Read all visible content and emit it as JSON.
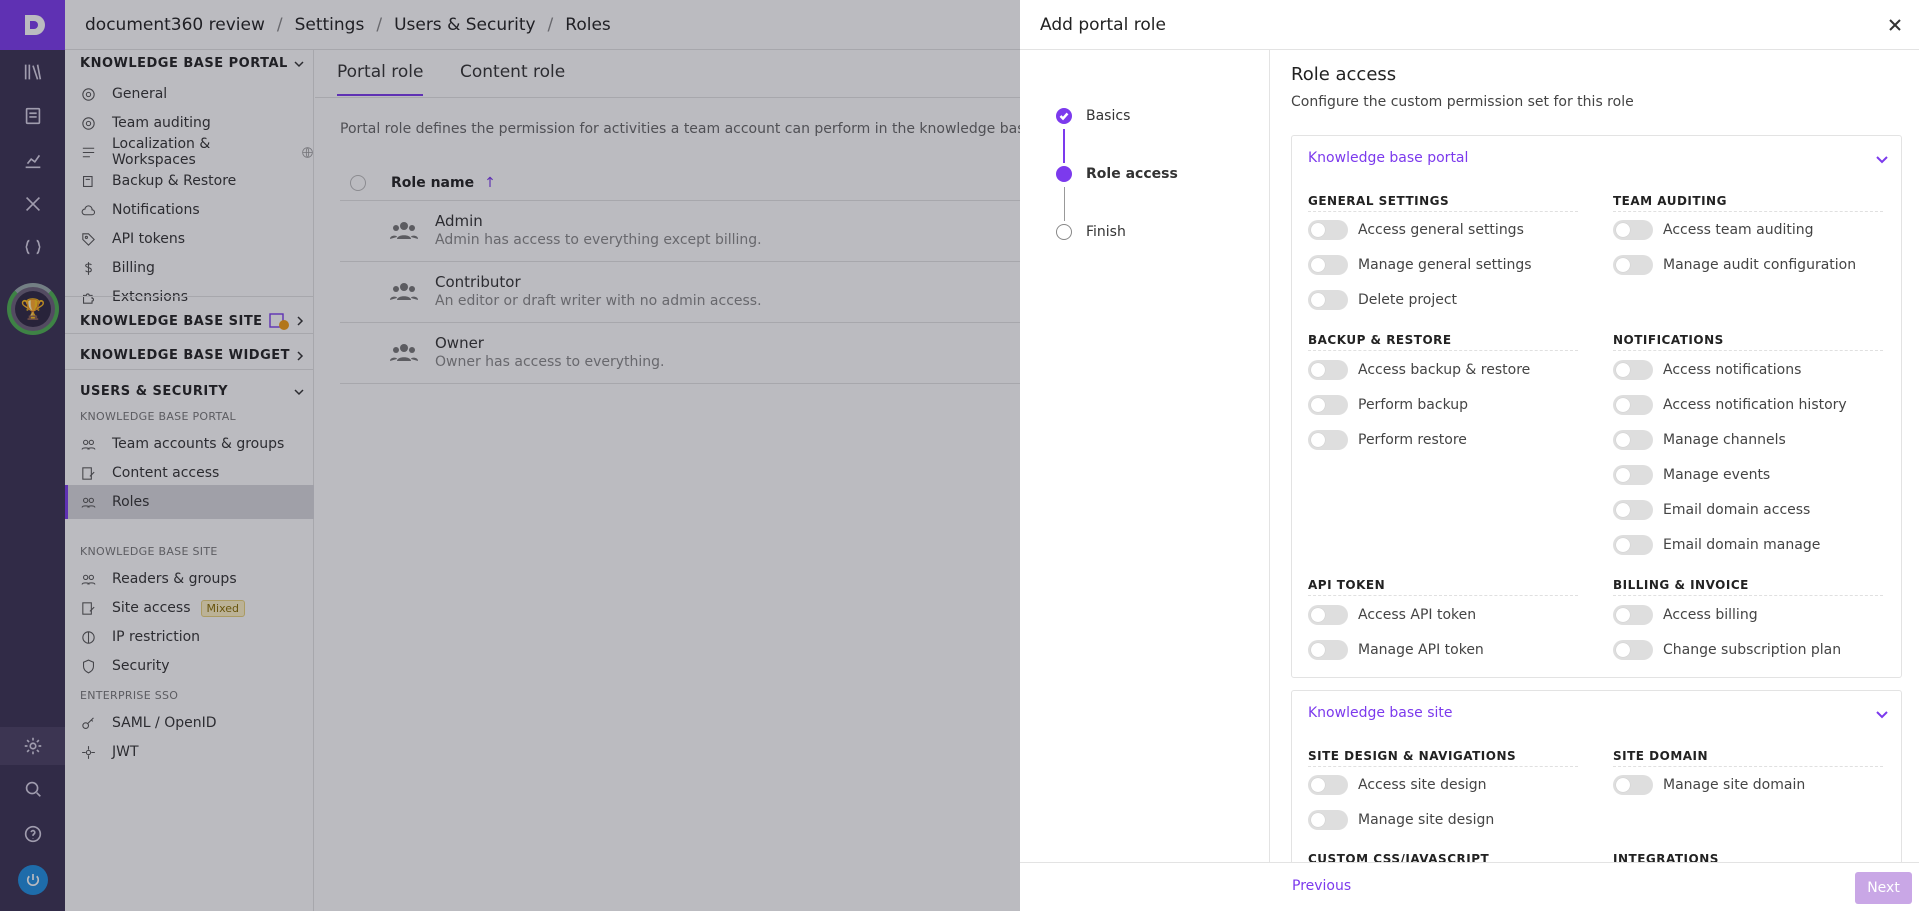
{
  "breadcrumb": [
    "document360 review",
    "Settings",
    "Users & Security",
    "Roles"
  ],
  "sidebar": {
    "kb_portal": {
      "title": "KNOWLEDGE BASE PORTAL",
      "items": [
        "General",
        "Team auditing",
        "Localization & Workspaces",
        "Backup & Restore",
        "Notifications",
        "API tokens",
        "Billing",
        "Extensions"
      ]
    },
    "kb_site": {
      "title": "KNOWLEDGE BASE SITE"
    },
    "kb_widget": {
      "title": "KNOWLEDGE BASE WIDGET"
    },
    "users_security": {
      "title": "USERS & SECURITY",
      "portal_label": "KNOWLEDGE BASE PORTAL",
      "portal_items": [
        "Team accounts & groups",
        "Content access",
        "Roles"
      ],
      "site_label": "KNOWLEDGE BASE SITE",
      "site_items": [
        "Readers & groups",
        "Site access",
        "IP restriction",
        "Security"
      ],
      "site_access_badge": "Mixed",
      "sso_label": "ENTERPRISE SSO",
      "sso_items": [
        "SAML / OpenID",
        "JWT"
      ]
    }
  },
  "tabs": [
    "Portal role",
    "Content role"
  ],
  "description": "Portal role defines the permission for activities a team account can perform in the knowledge base po",
  "table": {
    "header": "Role name",
    "rows": [
      {
        "name": "Admin",
        "desc": "Admin has access to everything except billing."
      },
      {
        "name": "Contributor",
        "desc": "An editor or draft writer with no admin access."
      },
      {
        "name": "Owner",
        "desc": "Owner has access to everything."
      }
    ]
  },
  "panel": {
    "title": "Add portal role",
    "steps": [
      "Basics",
      "Role access",
      "Finish"
    ],
    "section_title": "Role access",
    "section_sub": "Configure the custom permission set for this role",
    "kb_portal": {
      "title": "Knowledge base portal",
      "groups": {
        "general": {
          "title": "GENERAL SETTINGS",
          "perms": [
            "Access general settings",
            "Manage general settings",
            "Delete project"
          ]
        },
        "auditing": {
          "title": "TEAM AUDITING",
          "perms": [
            "Access team auditing",
            "Manage audit configuration"
          ]
        },
        "backup": {
          "title": "BACKUP & RESTORE",
          "perms": [
            "Access backup & restore",
            "Perform backup",
            "Perform restore"
          ]
        },
        "notifications": {
          "title": "NOTIFICATIONS",
          "perms": [
            "Access notifications",
            "Access notification history",
            "Manage channels",
            "Manage events",
            "Email domain access",
            "Email domain manage"
          ]
        },
        "api": {
          "title": "API TOKEN",
          "perms": [
            "Access API token",
            "Manage API token"
          ]
        },
        "billing": {
          "title": "BILLING & INVOICE",
          "perms": [
            "Access billing",
            "Change subscription plan"
          ]
        }
      }
    },
    "kb_site": {
      "title": "Knowledge base site",
      "groups": {
        "design": {
          "title": "SITE DESIGN & NAVIGATIONS",
          "perms": [
            "Access site design",
            "Manage site design"
          ]
        },
        "domain": {
          "title": "SITE DOMAIN",
          "perms": [
            "Manage site domain"
          ]
        },
        "css": {
          "title": "CUSTOM CSS/JAVASCRIPT"
        },
        "integrations": {
          "title": "INTEGRATIONS"
        }
      }
    },
    "footer": {
      "previous": "Previous",
      "next": "Next"
    }
  },
  "colors": {
    "accent": "#7c3aed",
    "rail": "#3a3152"
  }
}
